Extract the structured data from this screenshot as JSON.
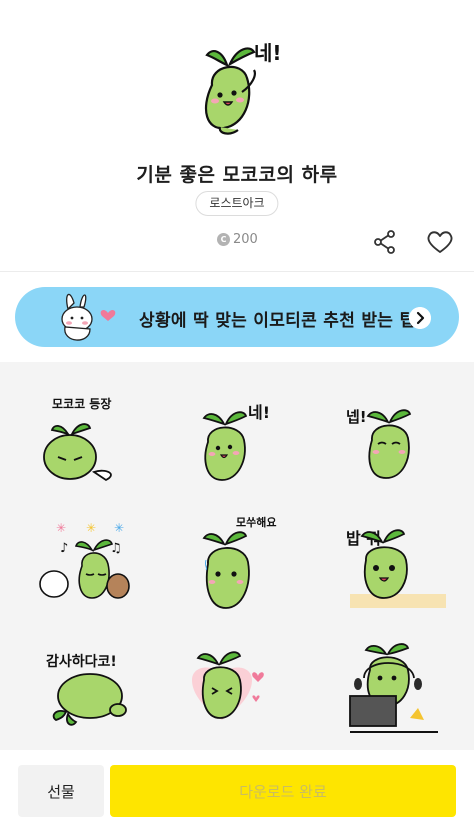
{
  "product": {
    "title": "기분 좋은 모코코의 하루",
    "author": "로스트아크",
    "price": "200",
    "coin_symbol": "C",
    "hero_bubble": "네!"
  },
  "actions": {
    "share_icon": "share-icon",
    "like_icon": "heart-outline-icon"
  },
  "banner": {
    "text": "상황에 딱 맞는 이모티콘 추천 받는 팁",
    "color": "#8bd6f7",
    "arrow_icon": "chevron-right-icon"
  },
  "stickers": [
    {
      "caption": "모코코 등장"
    },
    {
      "caption": "네!"
    },
    {
      "caption": "넵!"
    },
    {
      "caption": ""
    },
    {
      "caption": "모쑤해요"
    },
    {
      "caption": "밥 줘"
    },
    {
      "caption": "감사하다코!"
    },
    {
      "caption": ""
    },
    {
      "caption": ""
    }
  ],
  "footer": {
    "gift_label": "선물",
    "download_label": "다운로드 완료",
    "download_color": "#fee500"
  }
}
